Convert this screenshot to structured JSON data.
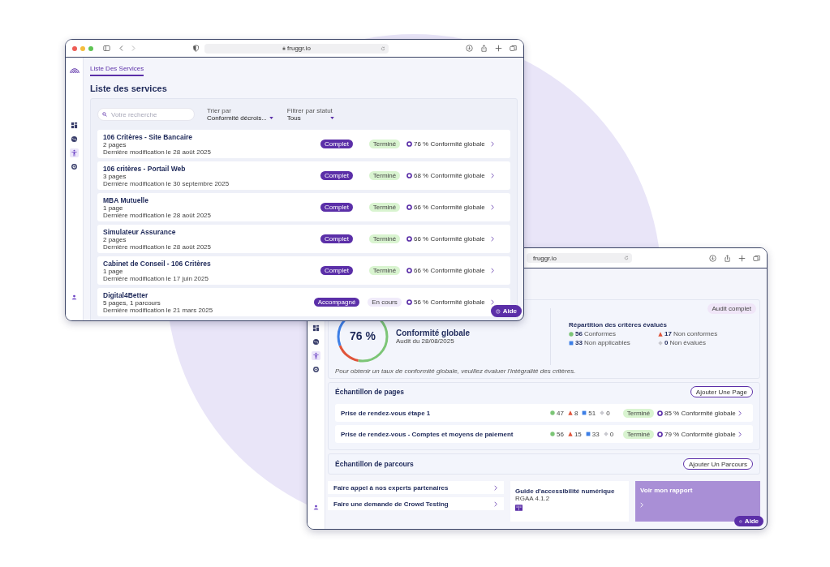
{
  "front_window": {
    "url": "fruggr.io",
    "sidebar": [
      {
        "kind": "grid",
        "selected": false
      },
      {
        "kind": "globe",
        "selected": false
      },
      {
        "kind": "accessibility",
        "selected": true
      },
      {
        "kind": "target",
        "selected": false
      }
    ],
    "tabs": [
      {
        "label": "Liste Des Services",
        "selected": true
      }
    ],
    "title": "Liste des services",
    "search": {
      "placeholder": "Votre recherche"
    },
    "filters": [
      {
        "label": "Trier par",
        "value": "Conformité décrois..."
      },
      {
        "label": "Filtrer par statut",
        "value": "Tous"
      }
    ],
    "services": [
      {
        "name": "106 Critères - Site Bancaire",
        "pages": "2 pages",
        "modified": "Dernière modification le 28 août 2025",
        "offer": "Complet",
        "status": {
          "label": "Terminé",
          "kind": "done"
        },
        "compliance": "76 % Conformité globale"
      },
      {
        "name": "106 critères - Portail Web",
        "pages": "3 pages",
        "modified": "Dernière modification le 30 septembre 2025",
        "offer": "Complet",
        "status": {
          "label": "Terminé",
          "kind": "done"
        },
        "compliance": "68 % Conformité globale"
      },
      {
        "name": "MBA Mutuelle",
        "pages": "1 page",
        "modified": "Dernière modification le 28 août 2025",
        "offer": "Complet",
        "status": {
          "label": "Terminé",
          "kind": "done"
        },
        "compliance": "66 % Conformité globale"
      },
      {
        "name": "Simulateur Assurance",
        "pages": "2 pages",
        "modified": "Dernière modification le 28 août 2025",
        "offer": "Complet",
        "status": {
          "label": "Terminé",
          "kind": "done"
        },
        "compliance": "66 % Conformité globale"
      },
      {
        "name": "Cabinet de Conseil - 106 Critères",
        "pages": "1 page",
        "modified": "Dernière modification le 17 juin 2025",
        "offer": "Complet",
        "status": {
          "label": "Terminé",
          "kind": "done"
        },
        "compliance": "66 % Conformité globale"
      },
      {
        "name": "Digital4Better",
        "pages": "5 pages, 1 parcours",
        "modified": "Dernière modification le 21 mars 2025",
        "offer": "Accompagné",
        "status": {
          "label": "En cours",
          "kind": "in_progress"
        },
        "compliance": "56 % Conformité globale"
      }
    ],
    "help_button": "Aide"
  },
  "back_window": {
    "url": "fruggr.io",
    "sidebar": [
      {
        "kind": "grid",
        "selected": false
      },
      {
        "kind": "globe",
        "selected": false
      },
      {
        "kind": "accessibility",
        "selected": true
      },
      {
        "kind": "target",
        "selected": false
      }
    ],
    "audit": {
      "badge": "Audit complet",
      "score": "76 %",
      "title": "Conformité globale",
      "date": "Audit du 28/08/2025",
      "breakdown_title": "Répartition des critères évalués",
      "breakdown": [
        {
          "count": "56",
          "label": "Conformes",
          "kind": "conform"
        },
        {
          "count": "17",
          "label": "Non conformes",
          "kind": "nonconform"
        },
        {
          "count": "33",
          "label": "Non applicables",
          "kind": "na"
        },
        {
          "count": "0",
          "label": "Non évalués",
          "kind": "unevaluated"
        }
      ],
      "note": "Pour obtenir un taux de conformité globale, veuillez évaluer l'intégralité des critères."
    },
    "pages": {
      "title": "Échantillon de pages",
      "button": "Ajouter Une Page",
      "rows": [
        {
          "name": "Prise de rendez-vous étape 1",
          "counts": [
            {
              "kind": "conform",
              "value": "47"
            },
            {
              "kind": "nonconform",
              "value": "8"
            },
            {
              "kind": "na",
              "value": "51"
            },
            {
              "kind": "unevaluated",
              "value": "0"
            }
          ],
          "status": {
            "label": "Terminé",
            "kind": "done"
          },
          "compliance": "85 % Conformité globale"
        },
        {
          "name": "Prise de rendez-vous - Comptes et moyens de paiement",
          "counts": [
            {
              "kind": "conform",
              "value": "56"
            },
            {
              "kind": "nonconform",
              "value": "15"
            },
            {
              "kind": "na",
              "value": "33"
            },
            {
              "kind": "unevaluated",
              "value": "0"
            }
          ],
          "status": {
            "label": "Terminé",
            "kind": "done"
          },
          "compliance": "79 % Conformité globale"
        }
      ]
    },
    "journeys": {
      "title": "Échantillon de parcours",
      "button": "Ajouter Un Parcours"
    },
    "links": [
      "Faire appel à nos experts partenaires",
      "Faire une demande de Crowd Testing"
    ],
    "guide": {
      "title": "Guide d'accessibilité numérique",
      "subtitle": "RGAA 4.1.2"
    },
    "report": {
      "label": "Voir mon rapport"
    },
    "help_button": "Aide"
  }
}
